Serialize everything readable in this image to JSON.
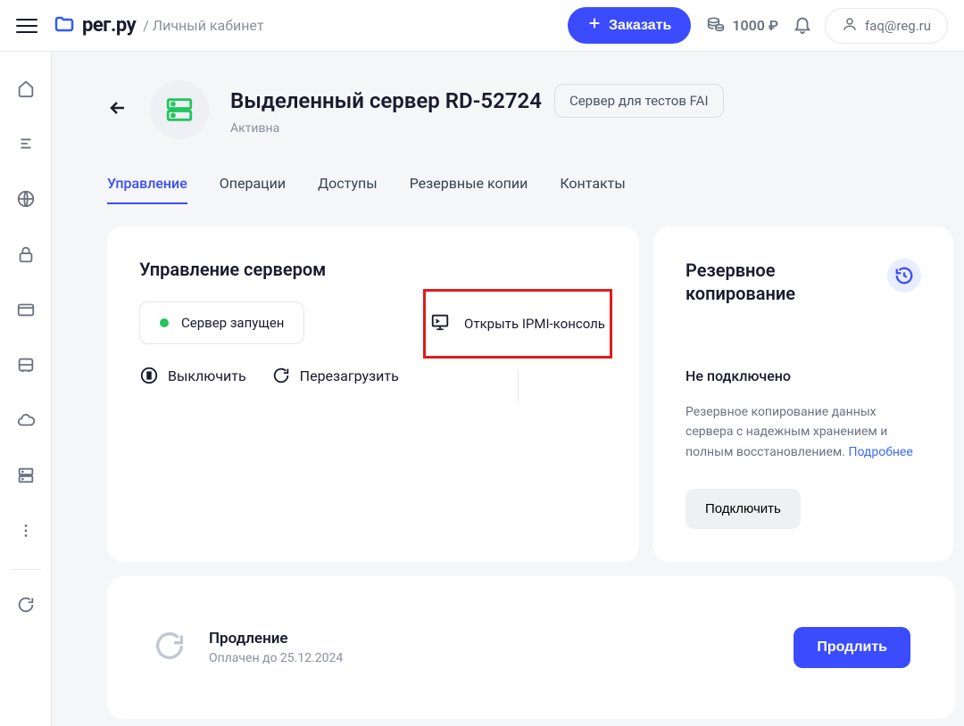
{
  "header": {
    "logo_text": "рег.ру",
    "breadcrumb": "/ Личный кабинет",
    "order_label": "Заказать",
    "balance": "1000 ₽",
    "account_email": "faq@reg.ru"
  },
  "sidebar_icons": [
    "home",
    "list",
    "globe",
    "lock",
    "card",
    "server",
    "cloud",
    "storage",
    "more",
    "loop"
  ],
  "page": {
    "title": "Выделенный сервер RD-52724",
    "tag": "Сервер для тестов FAI",
    "status": "Активна"
  },
  "tabs": [
    {
      "label": "Управление",
      "active": true
    },
    {
      "label": "Операции",
      "active": false
    },
    {
      "label": "Доступы",
      "active": false
    },
    {
      "label": "Резервные копии",
      "active": false
    },
    {
      "label": "Контакты",
      "active": false
    }
  ],
  "management": {
    "title": "Управление сервером",
    "running_label": "Сервер запущен",
    "shutdown_label": "Выключить",
    "restart_label": "Перезагрузить",
    "ipmi_label": "Открыть IPMI-консоль"
  },
  "backup": {
    "title": "Резервное копирование",
    "status": "Не подключено",
    "desc": "Резервное копирование данных сервера с надежным хранением и полным восстановлением.",
    "link": "Подробнее",
    "connect_label": "Подключить"
  },
  "renewal": {
    "title": "Продление",
    "subtitle": "Оплачен до 25.12.2024",
    "button_label": "Продлить"
  }
}
